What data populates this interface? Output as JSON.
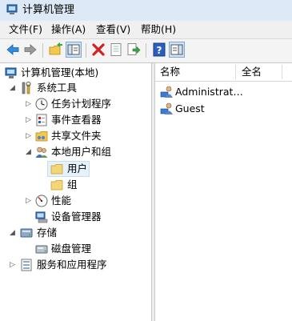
{
  "window": {
    "title": "计算机管理",
    "icon": "computer-management-icon"
  },
  "menu": [
    "文件(F)",
    "操作(A)",
    "查看(V)",
    "帮助(H)"
  ],
  "toolbar": [
    {
      "name": "back-button",
      "icon": "left-arrow-icon"
    },
    {
      "name": "forward-button",
      "icon": "right-arrow-icon"
    },
    {
      "name": "up-level-button",
      "icon": "folder-up-icon"
    },
    {
      "name": "show-hide-tree-button",
      "icon": "tree-pane-icon"
    },
    {
      "name": "delete-button",
      "icon": "red-x-icon"
    },
    {
      "name": "properties-button",
      "icon": "properties-icon"
    },
    {
      "name": "export-list-button",
      "icon": "export-icon"
    },
    {
      "name": "help-button",
      "icon": "help-icon"
    },
    {
      "name": "show-action-pane-button",
      "icon": "action-pane-icon"
    }
  ],
  "tree": {
    "root": "计算机管理(本地)",
    "system_tools": "系统工具",
    "task_scheduler": "任务计划程序",
    "event_viewer": "事件查看器",
    "shared_folders": "共享文件夹",
    "local_users_groups": "本地用户和组",
    "users": "用户",
    "groups": "组",
    "performance": "性能",
    "device_manager": "设备管理器",
    "storage": "存储",
    "disk_management": "磁盘管理",
    "services_apps": "服务和应用程序"
  },
  "list": {
    "columns": [
      "名称",
      "全名"
    ],
    "rows": [
      {
        "name": "Administrat…",
        "fullname": ""
      },
      {
        "name": "Guest",
        "fullname": ""
      }
    ]
  },
  "colors": {
    "selection": "#e5f1fb",
    "titlebar": "#dde9f7",
    "accent": "#1e64c8"
  }
}
